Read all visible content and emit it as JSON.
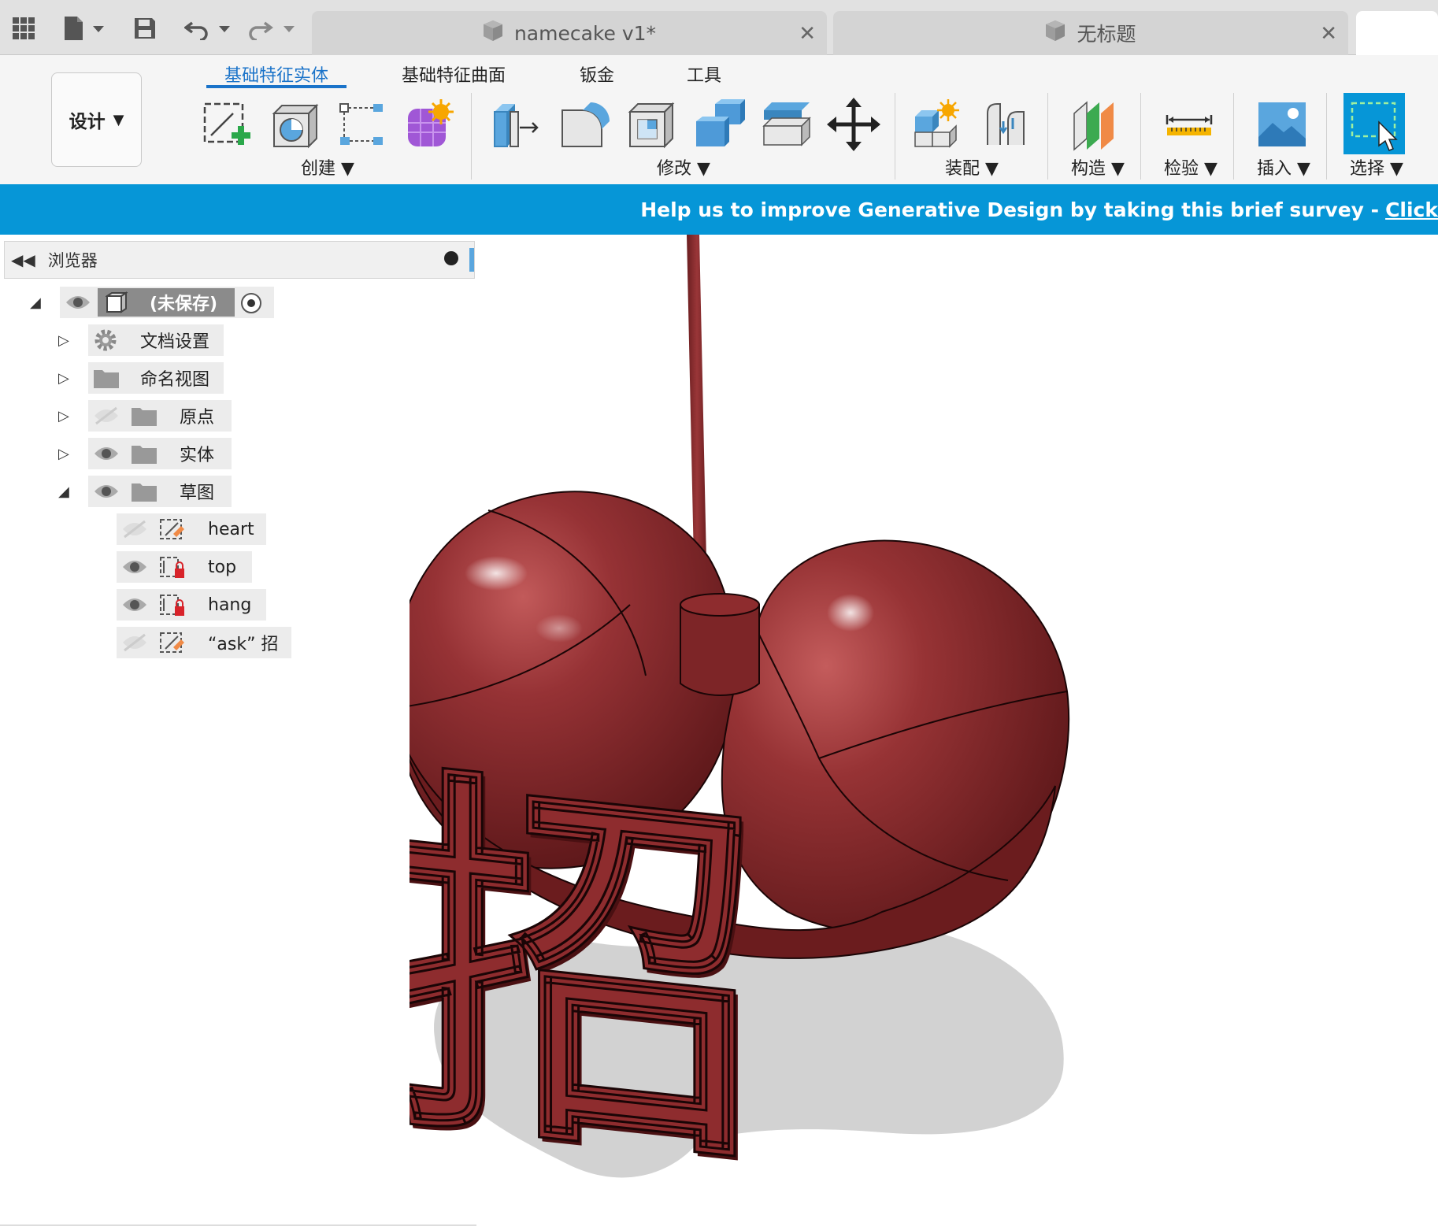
{
  "titlebar": {
    "tabs": [
      {
        "label": "namecake v1*",
        "active": false
      },
      {
        "label": "无标题",
        "active": false
      },
      {
        "label": "",
        "active": true
      }
    ]
  },
  "ribbon": {
    "workspace_label": "设计",
    "tabs": [
      "基础特征实体",
      "基础特征曲面",
      "钣金",
      "工具"
    ],
    "active_tab": "基础特征实体",
    "groups": [
      "创建",
      "修改",
      "装配",
      "构造",
      "检验",
      "插入",
      "选择"
    ]
  },
  "banner": {
    "text": "Help us to improve Generative Design by taking this brief survey - ",
    "link": "Click"
  },
  "browser": {
    "title": "浏览器",
    "root_label": "(未保存)",
    "items": [
      {
        "label": "文档设置",
        "icon": "gear-icon"
      },
      {
        "label": "命名视图",
        "icon": "folder-icon"
      },
      {
        "label": "原点",
        "icon": "folder-icon",
        "visible": false
      },
      {
        "label": "实体",
        "icon": "folder-icon",
        "visible": true
      },
      {
        "label": "草图",
        "icon": "folder-icon",
        "visible": true,
        "expanded": true
      }
    ],
    "sketches": [
      {
        "label": "heart",
        "visible": false
      },
      {
        "label": "top",
        "visible": true
      },
      {
        "label": "hang",
        "visible": true
      },
      {
        "label": "“ask” 招",
        "visible": false
      }
    ]
  },
  "model": {
    "glyph": "招",
    "color": "#8e2c2e"
  },
  "colors": {
    "accent": "#1a73c9",
    "banner": "#0696d7"
  }
}
